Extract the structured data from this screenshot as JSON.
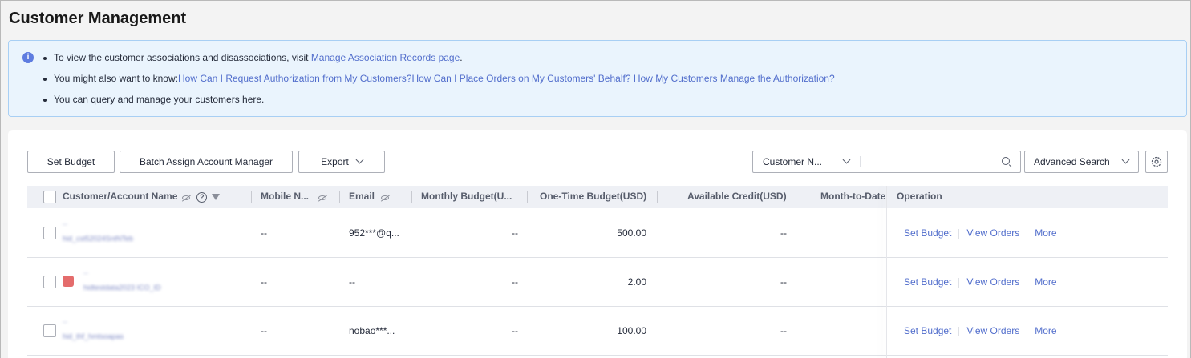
{
  "page": {
    "title": "Customer Management"
  },
  "notice": {
    "line1_text": "To view the customer associations and disassociations, visit ",
    "line1_link": "Manage Association Records page",
    "line1_suffix": ".",
    "line2_text": "You might also want to know:",
    "line2_link1": "How Can I Request Authorization from My Customers?",
    "line2_link2": "How Can I Place Orders on My Customers' Behalf?",
    "line2_link3": " How My Customers Manage the Authorization?",
    "line3_text": "You can query and manage your customers here."
  },
  "toolbar": {
    "set_budget": "Set Budget",
    "batch_assign": "Batch Assign Account Manager",
    "export": "Export",
    "search_field": "Customer N...",
    "search_placeholder": "",
    "advanced_search": "Advanced Search"
  },
  "table": {
    "columns": {
      "name": "Customer/Account Name",
      "mobile": "Mobile N...",
      "email": "Email",
      "monthly": "Monthly Budget(U...",
      "onetime": "One-Time Budget(USD)",
      "credit": "Available Credit(USD)",
      "mtd": "Month-to-Date",
      "operation": "Operation"
    },
    "rows": [
      {
        "name_top": "--",
        "name_bottom": "hid_cst52024SntNTeb",
        "mobile": "--",
        "email": "952***@q...",
        "monthly": "--",
        "onetime": "500.00",
        "credit": "--",
        "op1": "Set Budget",
        "op2": "View Orders",
        "op3": "More"
      },
      {
        "name_top": "--",
        "name_bottom": "hidtestdata2023 ICO_ID",
        "mobile": "--",
        "email": "--",
        "monthly": "--",
        "onetime": "2.00",
        "credit": "--",
        "op1": "Set Budget",
        "op2": "View Orders",
        "op3": "More"
      },
      {
        "name_top": "--",
        "name_bottom": "hid_thf_hmtsoapas",
        "mobile": "--",
        "email": "nobao***...",
        "monthly": "--",
        "onetime": "100.00",
        "credit": "--",
        "op1": "Set Budget",
        "op2": "View Orders",
        "op3": "More"
      }
    ]
  },
  "colors": {
    "link": "#526ecc",
    "notice_bg": "#eaf4fd",
    "header_bg": "#eef0f5"
  }
}
